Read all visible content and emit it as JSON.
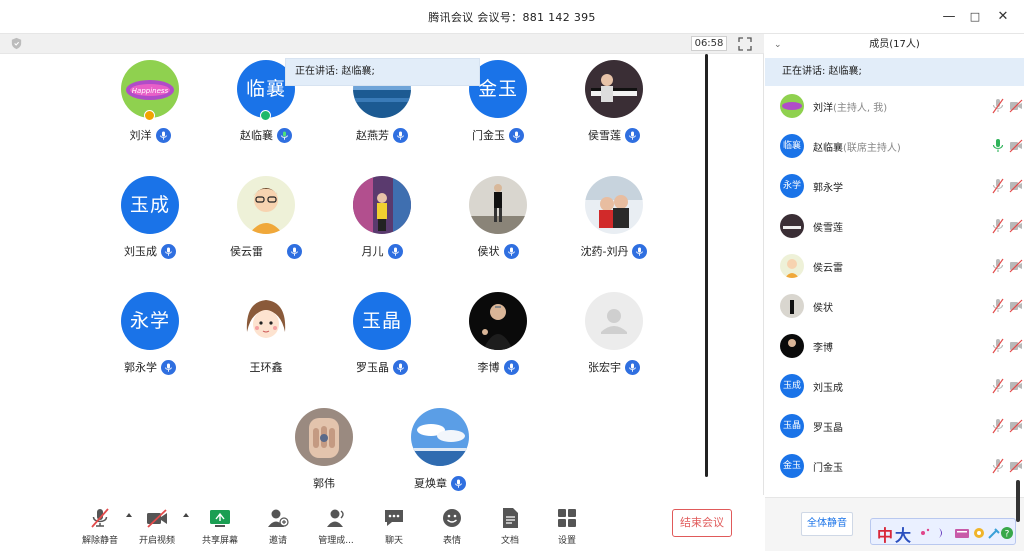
{
  "window": {
    "title": "腾讯会议 会议号：881 142 395",
    "controls": [
      "minimize-icon",
      "maximize-icon",
      "close-icon"
    ]
  },
  "meeting": {
    "timer": "06:58",
    "speaking_text": "正在讲话: 赵临襄;"
  },
  "colors": {
    "accent": "#1a73e8",
    "speaking_bg": "#e2edf9",
    "end_red": "#e05a5a",
    "host_badge": "#f2a400",
    "cohost_badge": "#1fb86a"
  },
  "participants": [
    {
      "name": "刘洋",
      "avatar": "photo-happiness",
      "badge": "host"
    },
    {
      "name": "赵临襄",
      "avatar_text": "临襄",
      "badge": "cohost"
    },
    {
      "name": "赵燕芳",
      "avatar": "photo-sea"
    },
    {
      "name": "门金玉",
      "avatar_text": "金玉"
    },
    {
      "name": "侯雪莲",
      "avatar": "photo-piano"
    },
    {
      "name": "刘玉成",
      "avatar_text": "玉成"
    },
    {
      "name": "侯云雷",
      "avatar": "photo-cartoon-boy"
    },
    {
      "name": "月儿",
      "avatar": "photo-girl-street"
    },
    {
      "name": "侯状",
      "avatar": "photo-man-standing"
    },
    {
      "name": "沈药-刘丹",
      "avatar": "photo-snow-kids"
    },
    {
      "name": "郭永学",
      "avatar_text": "永学"
    },
    {
      "name": "王环鑫",
      "avatar": "photo-cartoon-girl"
    },
    {
      "name": "罗玉晶",
      "avatar_text": "玉晶"
    },
    {
      "name": "李博",
      "avatar": "photo-presenter"
    },
    {
      "name": "张宏宇",
      "avatar": "default-avatar"
    },
    {
      "name": "郭伟",
      "avatar": "photo-hands"
    },
    {
      "name": "夏焕章",
      "avatar": "photo-sky"
    }
  ],
  "toolbar": {
    "unmute": "解除静音",
    "start_video": "开启视频",
    "share_screen": "共享屏幕",
    "invite": "邀请",
    "manage": "管理成...",
    "chat": "聊天",
    "emoji": "表情",
    "docs": "文档",
    "settings": "设置",
    "end_meeting": "结束会议"
  },
  "members_panel": {
    "title": "成员(17人)",
    "speaking_text": "正在讲话: 赵临襄;",
    "mute_all": "全体静音",
    "members": [
      {
        "name": "刘洋",
        "role": "(主持人, 我)",
        "avatar": "photo-happiness",
        "mic": "muted"
      },
      {
        "name": "赵临襄",
        "role": "(联席主持人)",
        "avatar_text": "临襄",
        "mic": "active"
      },
      {
        "name": "郭永学",
        "avatar_text": "永学",
        "mic": "muted"
      },
      {
        "name": "侯雪莲",
        "avatar": "photo-piano",
        "mic": "muted"
      },
      {
        "name": "侯云雷",
        "avatar": "photo-cartoon-boy",
        "mic": "muted"
      },
      {
        "name": "侯状",
        "avatar": "photo-man-standing",
        "mic": "muted"
      },
      {
        "name": "李博",
        "avatar": "photo-presenter",
        "mic": "muted"
      },
      {
        "name": "刘玉成",
        "avatar_text": "玉成",
        "mic": "muted"
      },
      {
        "name": "罗玉晶",
        "avatar_text": "玉晶",
        "mic": "muted"
      },
      {
        "name": "门金玉",
        "avatar_text": "金玉",
        "mic": "muted"
      }
    ]
  },
  "ime": {
    "chars": [
      "中",
      "大"
    ]
  }
}
